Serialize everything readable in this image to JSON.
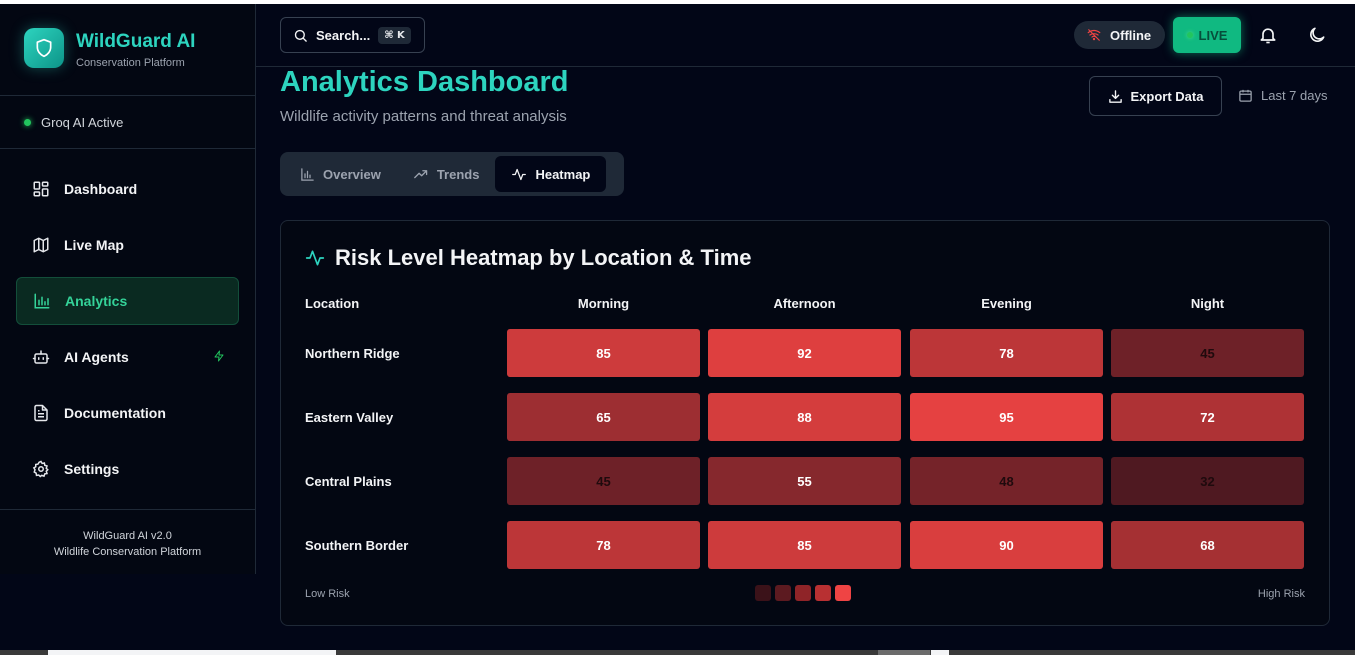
{
  "brand": {
    "title": "WildGuard AI",
    "subtitle": "Conservation Platform"
  },
  "status": {
    "label": "Groq AI Active"
  },
  "sidebar": {
    "items": [
      {
        "label": "Dashboard",
        "icon": "layout-grid-icon"
      },
      {
        "label": "Live Map",
        "icon": "map-icon"
      },
      {
        "label": "Analytics",
        "icon": "bar-chart-icon",
        "active": true
      },
      {
        "label": "AI Agents",
        "icon": "bot-icon",
        "extra_icon": "zap-icon"
      },
      {
        "label": "Documentation",
        "icon": "file-text-icon"
      },
      {
        "label": "Settings",
        "icon": "gear-icon"
      }
    ],
    "footer_line1": "WildGuard AI v2.0",
    "footer_line2": "Wildlife Conservation Platform"
  },
  "topbar": {
    "search_label": "Search...",
    "search_shortcut": "⌘ K",
    "offline_label": "Offline",
    "live_label": "LIVE"
  },
  "header": {
    "title": "Analytics Dashboard",
    "subtitle": "Wildlife activity patterns and threat analysis",
    "export_label": "Export Data",
    "date_range": "Last 7 days"
  },
  "tabs": [
    {
      "label": "Overview",
      "icon": "bar-chart-icon"
    },
    {
      "label": "Trends",
      "icon": "trending-up-icon"
    },
    {
      "label": "Heatmap",
      "icon": "activity-icon",
      "active": true
    }
  ],
  "heatmap": {
    "title": "Risk Level Heatmap by Location & Time",
    "location_header": "Location",
    "columns": [
      "Morning",
      "Afternoon",
      "Evening",
      "Night"
    ],
    "rows": [
      {
        "location": "Northern Ridge",
        "values": [
          "85",
          "92",
          "78",
          "45"
        ]
      },
      {
        "location": "Eastern Valley",
        "values": [
          "65",
          "88",
          "95",
          "72"
        ]
      },
      {
        "location": "Central Plains",
        "values": [
          "45",
          "55",
          "48",
          "32"
        ]
      },
      {
        "location": "Southern Border",
        "values": [
          "78",
          "85",
          "90",
          "68"
        ]
      }
    ],
    "legend_low": "Low Risk",
    "legend_high": "High Risk",
    "legend_colors": [
      "#3b1219",
      "#5c1a20",
      "#8f2428",
      "#b83032",
      "#ef4444"
    ]
  },
  "colors": {
    "accent": "#2dd4bf",
    "live": "#10b981",
    "risk_high": "#e54141",
    "risk_low": "#4a1820"
  }
}
